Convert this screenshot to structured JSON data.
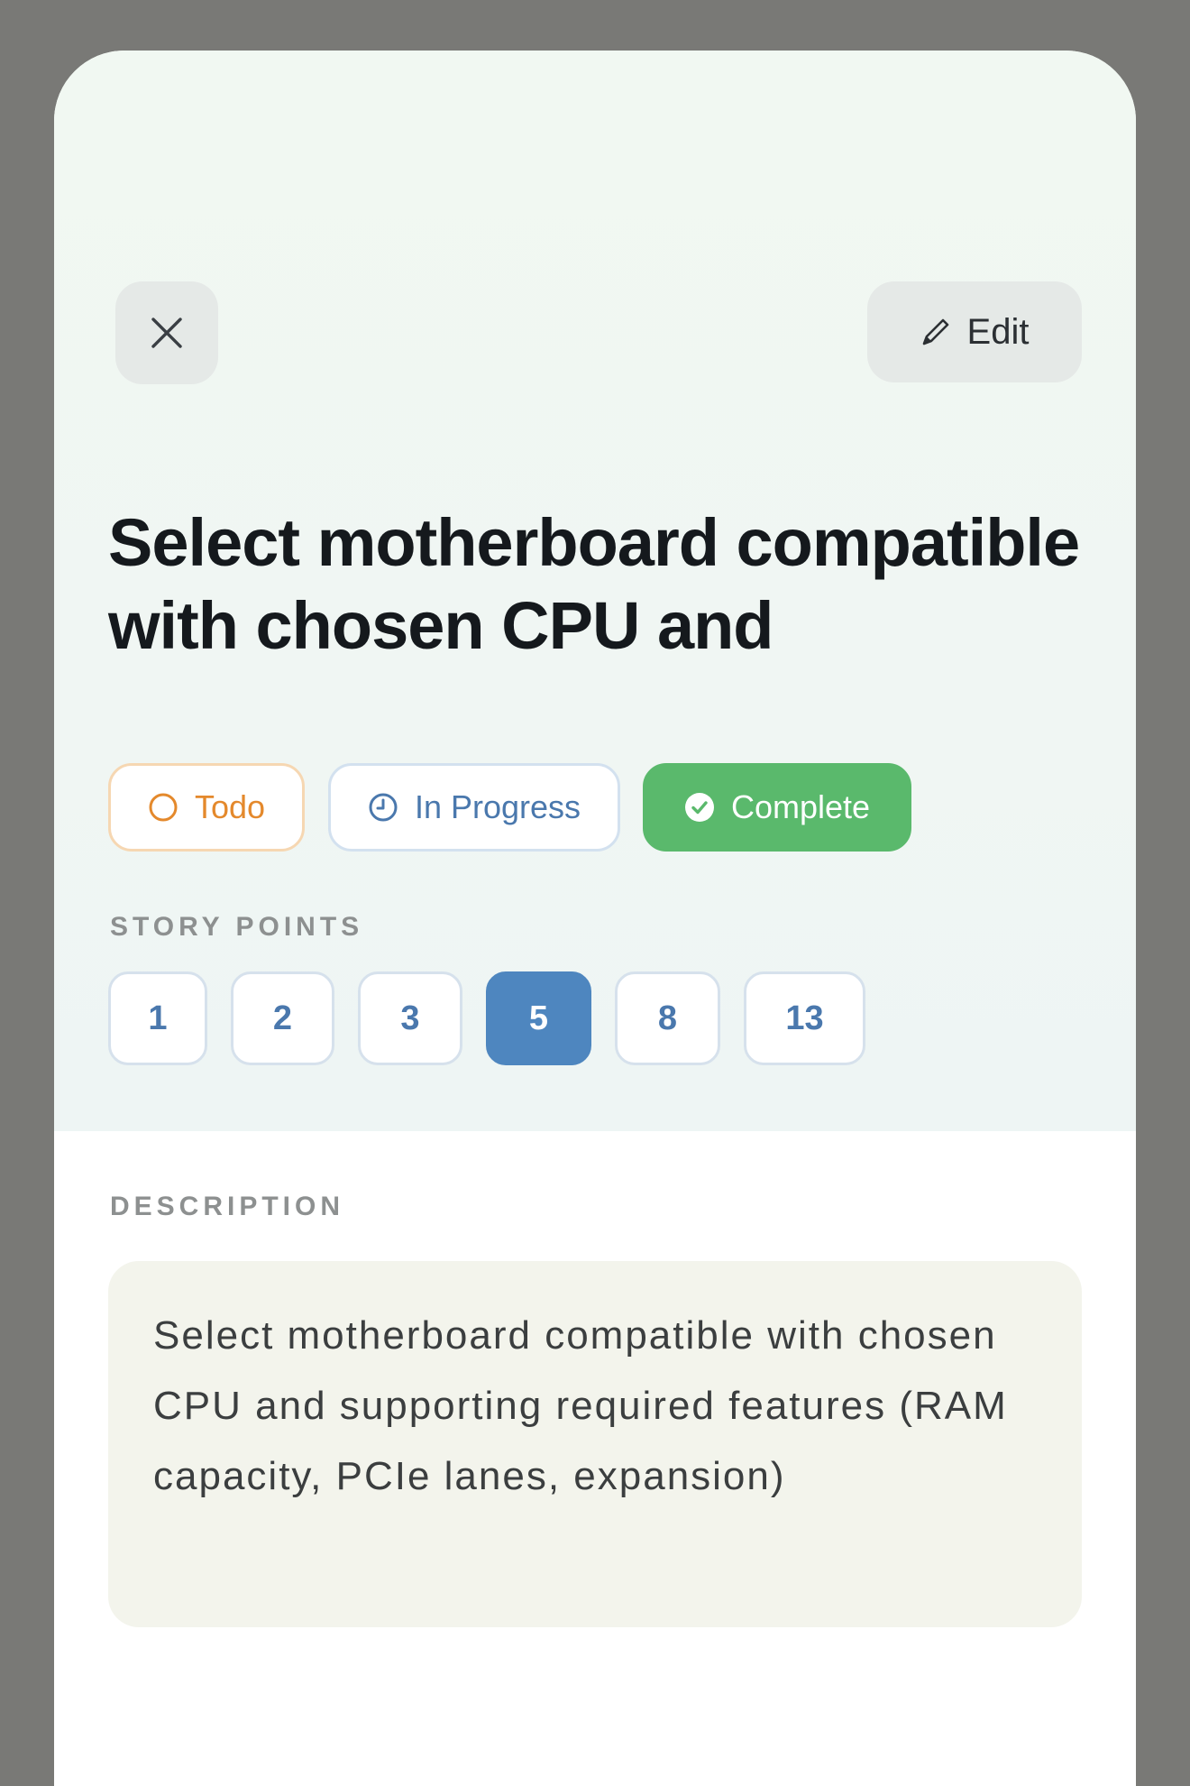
{
  "header": {
    "close_icon": "close-icon",
    "edit_icon": "pencil-icon",
    "edit_label": "Edit"
  },
  "task": {
    "title": "Select motherboard compatible with chosen CPU and"
  },
  "status": {
    "options": [
      {
        "label": "Todo",
        "icon": "circle-icon",
        "color": "#e4892c"
      },
      {
        "label": "In Progress",
        "icon": "clock-icon",
        "color": "#4a78ad"
      },
      {
        "label": "Complete",
        "icon": "check-circle-icon",
        "color": "#5ab96c"
      }
    ],
    "selected": "Complete"
  },
  "story_points": {
    "label": "STORY POINTS",
    "options": [
      "1",
      "2",
      "3",
      "5",
      "8",
      "13"
    ],
    "selected": "5"
  },
  "description": {
    "label": "DESCRIPTION",
    "text": "Select motherboard compatible with chosen CPU and supporting required features (RAM capacity, PCIe lanes, expansion)"
  },
  "colors": {
    "accent_blue": "#4e86bf",
    "complete_green": "#5ab96c",
    "todo_orange": "#e4892c"
  }
}
